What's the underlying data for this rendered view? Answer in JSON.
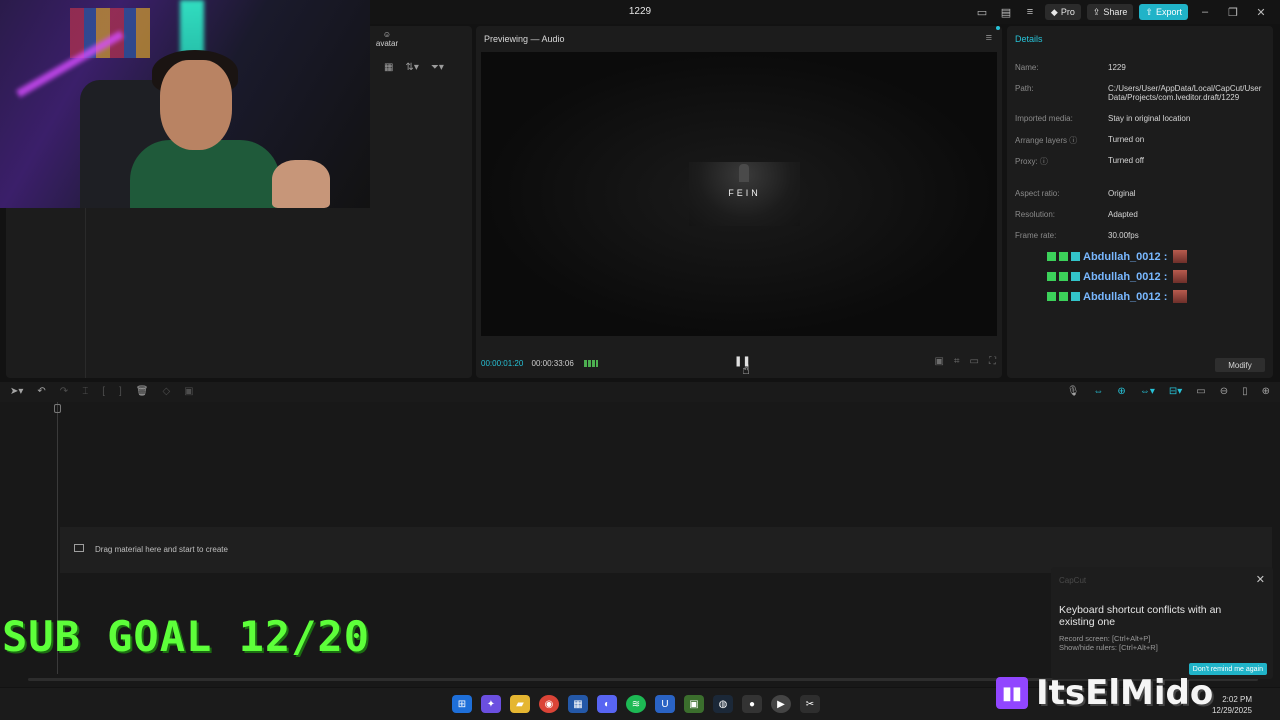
{
  "window": {
    "title": "1229"
  },
  "titlebar": {
    "pro_label": "Pro",
    "share_label": "Share",
    "export_label": "Export"
  },
  "media": {
    "avatar_label": "avatar"
  },
  "preview": {
    "title": "Previewing — Audio",
    "video_text": "FEIN",
    "current_time": "00:00:01:20",
    "total_time": "00:00:33:06"
  },
  "details": {
    "title": "Details",
    "rows": [
      {
        "key": "Name:",
        "value": "1229"
      },
      {
        "key": "Path:",
        "value": "C:/Users/User/AppData/Local/CapCut/User Data/Projects/com.lveditor.draft/1229"
      },
      {
        "key": "Imported media:",
        "value": "Stay in original location"
      },
      {
        "key": "Arrange layers ⓘ",
        "value": "Turned on"
      },
      {
        "key": "Proxy: ⓘ",
        "value": "Turned off"
      },
      {
        "key": "Aspect ratio:",
        "value": "Original"
      },
      {
        "key": "Resolution:",
        "value": "Adapted"
      },
      {
        "key": "Frame rate:",
        "value": "30.00fps"
      }
    ],
    "chat": [
      {
        "user": "Abdullah_0012 :"
      },
      {
        "user": "Abdullah_0012 :"
      },
      {
        "user": "Abdullah_0012 :"
      }
    ],
    "modify_label": "Modify"
  },
  "timeline": {
    "drop_hint": "Drag material here and start to create"
  },
  "overlay": {
    "sub_goal": "SUB GOAL 12/20",
    "streamer": "ItsElMido"
  },
  "notification": {
    "app": "CapCut",
    "heading": "Keyboard shortcut conflicts with an existing one",
    "line1": "Record screen: [Ctrl+Alt+P]",
    "line2": "Show/hide rulers: [Ctrl+Alt+R]",
    "button": "Don't remind me again"
  },
  "taskbar": {
    "time": "2:02 PM",
    "date": "12/29/2025"
  },
  "colors": {
    "accent": "#27c2d7",
    "sub_goal": "#5dff3a",
    "twitch": "#9146ff",
    "chat_user": "#79b8ff"
  }
}
